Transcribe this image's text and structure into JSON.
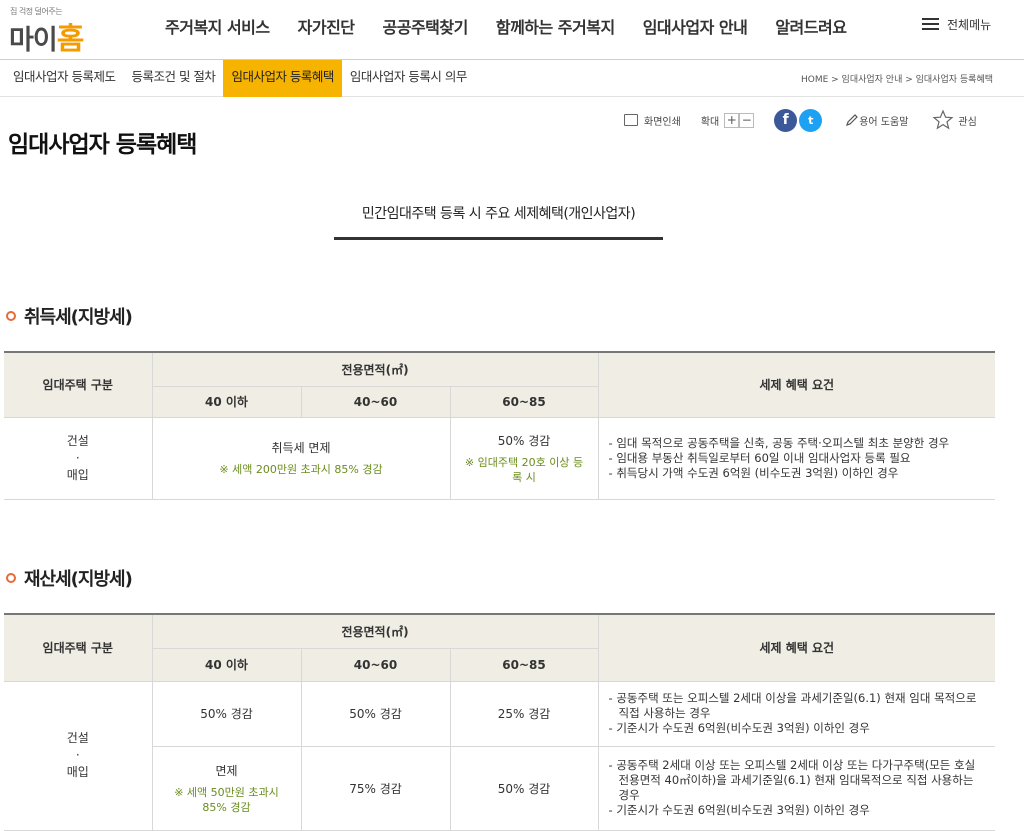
{
  "header": {
    "logo_tagline": "집 걱정 덜어주는",
    "logo_text_a": "마이",
    "logo_text_b": "홈",
    "menu": [
      "주거복지 서비스",
      "자가진단",
      "공공주택찾기",
      "함께하는 주거복지",
      "임대사업자 안내",
      "알려드려요"
    ],
    "all_menu": "전체메뉴"
  },
  "subnav": {
    "tabs": [
      "임대사업자 등록제도",
      "등록조건 및 절차",
      "임대사업자 등록혜택",
      "임대사업자 등록시 의무"
    ],
    "active_index": 2,
    "breadcrumb": "HOME > 임대사업자 안내 > 임대사업자 등록혜택"
  },
  "page": {
    "title": "임대사업자 등록혜택",
    "tools": {
      "print": "화면인쇄",
      "zoom": "확대",
      "zoom_in": "+",
      "zoom_out": "−",
      "facebook": "f",
      "twitter": "t",
      "glossary": "용어 도움말",
      "favorite": "관심"
    },
    "box_title": "민간임대주택 등록 시 주요 세제혜택(개인사업자)"
  },
  "acquisition": {
    "title": "취득세(지방세)",
    "headers": {
      "type": "임대주택 구분",
      "area": "전용면적(㎡)",
      "col1": "40 이하",
      "col2": "40~60",
      "col3": "60~85",
      "req": "세제 혜택 요건"
    },
    "row_label": [
      "건설",
      "·",
      "매입"
    ],
    "exempt": "취득세 면제",
    "exempt_note": "※ 세액 200만원 초과시 85% 경감",
    "reduce": "50% 경감",
    "reduce_note": "※ 임대주택 20호 이상 등록 시",
    "requirements": [
      "- 임대 목적으로 공동주택을 신축, 공동 주택·오피스텔 최초 분양한 경우",
      "- 임대용 부동산 취득일로부터 60일 이내 임대사업자 등록 필요",
      "- 취득당시 가액 수도권 6억원 (비수도권 3억원) 이하인 경우"
    ]
  },
  "property": {
    "title": "재산세(지방세)",
    "headers": {
      "type": "임대주택 구분",
      "area": "전용면적(㎡)",
      "col1": "40 이하",
      "col2": "40~60",
      "col3": "60~85",
      "req": "세제 혜택 요건"
    },
    "row_label": [
      "건설",
      "·",
      "매입"
    ],
    "row1": {
      "c1": "50% 경감",
      "c2": "50% 경감",
      "c3": "25% 경감",
      "requirements": [
        "- 공동주택 또는 오피스텔 2세대 이상을 과세기준일(6.1) 현재 임대 목적으로 직접 사용하는 경우",
        "- 기준시가 수도권 6억원(비수도권 3억원) 이하인 경우"
      ]
    },
    "row2": {
      "c1": "면제",
      "c1_note": "※ 세액 50만원 초과시 85% 경감",
      "c2": "75% 경감",
      "c3": "50% 경감",
      "requirements": [
        "- 공동주택 2세대 이상 또는 오피스텔 2세대 이상 또는 다가구주택(모든 호실 전용면적 40㎡이하)을 과세기준일(6.1) 현재 임대목적으로 직접 사용하는 경우",
        "- 기준시가 수도권 6억원(비수도권 3억원) 이하인 경우"
      ]
    }
  },
  "colors": {
    "accent_tab": "#f6b400",
    "logo_orange": "#f59b00",
    "note_green": "#6b8c1c",
    "bullet": "#e86a3b",
    "table_header": "#f0eee4"
  }
}
